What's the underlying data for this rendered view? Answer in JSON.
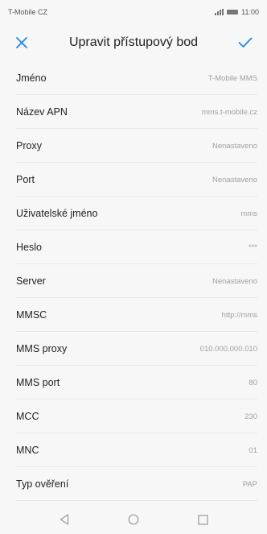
{
  "status_bar": {
    "carrier": "T-Mobile CZ",
    "time": "11:00"
  },
  "header": {
    "title": "Upravit přístupový bod",
    "cancel_icon": "close-icon",
    "confirm_icon": "check-icon",
    "accent": "#1e88e5"
  },
  "apn_fields": [
    {
      "label": "Jméno",
      "value": "T-Mobile MMS"
    },
    {
      "label": "Název APN",
      "value": "mms.t-mobile.cz"
    },
    {
      "label": "Proxy",
      "value": "Nenastaveno"
    },
    {
      "label": "Port",
      "value": "Nenastaveno"
    },
    {
      "label": "Uživatelské jméno",
      "value": "mms"
    },
    {
      "label": "Heslo",
      "value": "***"
    },
    {
      "label": "Server",
      "value": "Nenastaveno"
    },
    {
      "label": "MMSC",
      "value": "http://mms"
    },
    {
      "label": "MMS proxy",
      "value": "010.000.000.010"
    },
    {
      "label": "MMS port",
      "value": "80"
    },
    {
      "label": "MCC",
      "value": "230"
    },
    {
      "label": "MNC",
      "value": "01"
    },
    {
      "label": "Typ ověření",
      "value": "PAP"
    }
  ],
  "navbar": {
    "back_icon": "back-triangle-icon",
    "home_icon": "home-circle-icon",
    "recents_icon": "recents-square-icon"
  }
}
